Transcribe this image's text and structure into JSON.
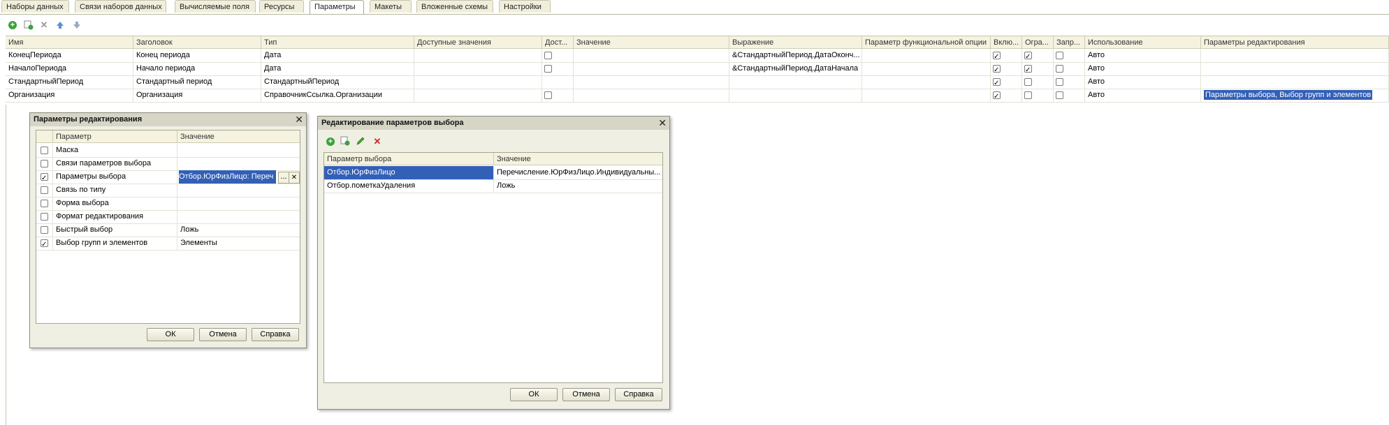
{
  "tabs": [
    "Наборы данных",
    "Связи наборов данных",
    "Вычисляемые поля",
    "Ресурсы",
    "Параметры",
    "Макеты",
    "Вложенные схемы",
    "Настройки"
  ],
  "active_tab": 4,
  "toolbar_icons": [
    "add-icon",
    "copy-add-icon",
    "delete-icon",
    "move-up-icon",
    "move-down-icon"
  ],
  "grid": {
    "headers": [
      "Имя",
      "Заголовок",
      "Тип",
      "Доступные значения",
      "Дост...",
      "Значение",
      "Выражение",
      "Параметр функциональной опции",
      "Вклю...",
      "Огра...",
      "Запр...",
      "Использование",
      "Параметры редактирования"
    ],
    "rows": [
      {
        "name": "КонецПериода",
        "title": "Конец периода",
        "type": "Дата",
        "avail": "",
        "dost": false,
        "value": "",
        "expr": "&СтандартныйПериод.ДатаОконч...",
        "func": "",
        "incl": true,
        "limit": true,
        "forbid": false,
        "usage": "Авто",
        "edit": ""
      },
      {
        "name": "НачалоПериода",
        "title": "Начало периода",
        "type": "Дата",
        "avail": "",
        "dost": false,
        "value": "",
        "expr": "&СтандартныйПериод.ДатаНачала",
        "func": "",
        "incl": true,
        "limit": true,
        "forbid": false,
        "usage": "Авто",
        "edit": ""
      },
      {
        "name": "СтандартныйПериод",
        "title": "Стандартный период",
        "type": "СтандартныйПериод",
        "avail": "",
        "dost": null,
        "value": "",
        "expr": "",
        "func": "",
        "incl": true,
        "limit": false,
        "forbid": false,
        "usage": "Авто",
        "edit": ""
      },
      {
        "name": "Организация",
        "title": "Организация",
        "type": "СправочникСсылка.Организации",
        "avail": "",
        "dost": false,
        "value": "",
        "expr": "",
        "func": "",
        "incl": true,
        "limit": false,
        "forbid": false,
        "usage": "Авто",
        "edit": "Параметры выбора, Выбор групп и элементов"
      }
    ]
  },
  "edit_dialog": {
    "title": "Параметры редактирования",
    "headers": [
      "Параметр",
      "Значение"
    ],
    "rows": [
      {
        "checked": false,
        "name": "Маска",
        "value": ""
      },
      {
        "checked": false,
        "name": "Связи параметров выбора",
        "value": ""
      },
      {
        "checked": true,
        "name": "Параметры выбора",
        "value": "Отбор.ЮрФизЛицо: Переч"
      },
      {
        "checked": false,
        "name": "Связь по типу",
        "value": ""
      },
      {
        "checked": false,
        "name": "Форма выбора",
        "value": ""
      },
      {
        "checked": false,
        "name": "Формат редактирования",
        "value": ""
      },
      {
        "checked": false,
        "name": "Быстрый выбор",
        "value": "Ложь"
      },
      {
        "checked": true,
        "name": "Выбор групп и элементов",
        "value": "Элементы"
      }
    ],
    "buttons": {
      "ok": "ОК",
      "cancel": "Отмена",
      "help": "Справка"
    },
    "ellipsis": "...",
    "clear": "✕"
  },
  "choice_dialog": {
    "title": "Редактирование параметров выбора",
    "headers": [
      "Параметр выбора",
      "Значение"
    ],
    "rows": [
      {
        "name": "Отбор.ЮрФизЛицо",
        "value": "Перечисление.ЮрФизЛицо.Индивидуальны..."
      },
      {
        "name": "Отбор.пометкаУдаления",
        "value": "Ложь"
      }
    ],
    "buttons": {
      "ok": "ОК",
      "cancel": "Отмена",
      "help": "Справка"
    }
  },
  "colors": {
    "accent": "#3360b7",
    "add": "#3aa33a",
    "delete": "#cc2a2a",
    "header_bg": "#f5f3df"
  }
}
